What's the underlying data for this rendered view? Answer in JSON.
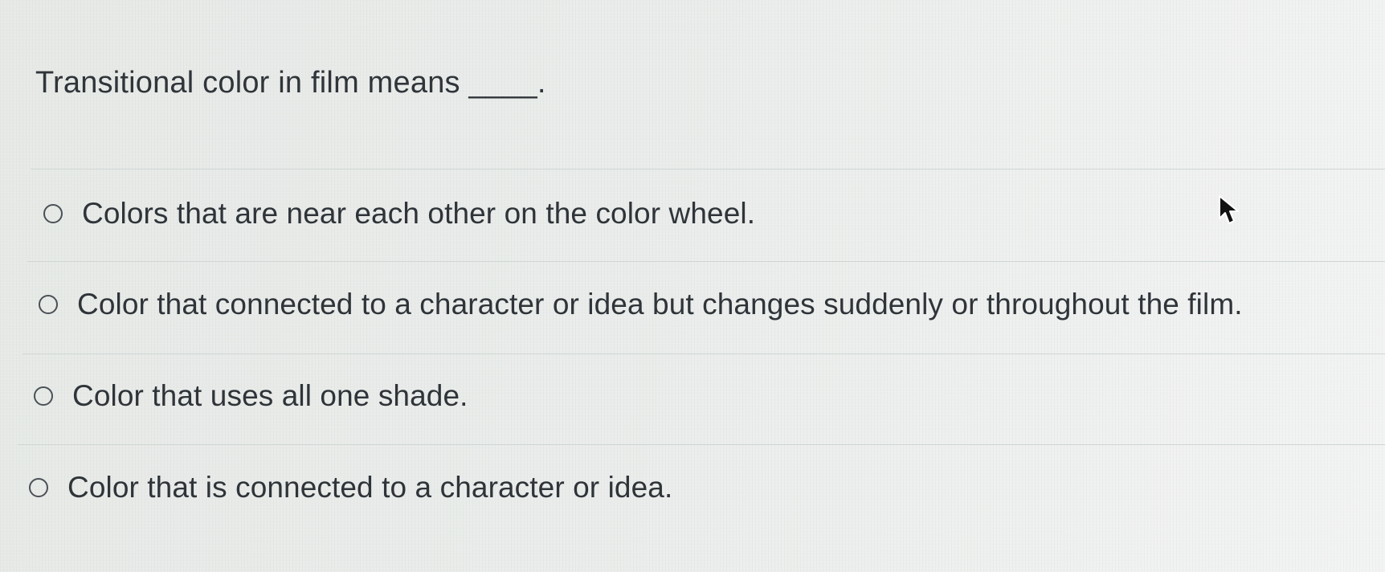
{
  "question": {
    "text": "Transitional color in film means ____."
  },
  "answers": [
    {
      "text": "Colors that are near each other on the color wheel."
    },
    {
      "text": "Color that connected to a character or idea but changes suddenly or throughout the film."
    },
    {
      "text": "Color that uses all one shade."
    },
    {
      "text": "Color that is connected to a character or idea."
    }
  ],
  "colors": {
    "background": "#e9ecea",
    "text": "#2f3439",
    "divider": "#cfd6d4",
    "radio_border": "#4a5056"
  },
  "icons": {
    "radio": "radio-button-unselected-icon",
    "cursor": "mouse-pointer-icon"
  }
}
